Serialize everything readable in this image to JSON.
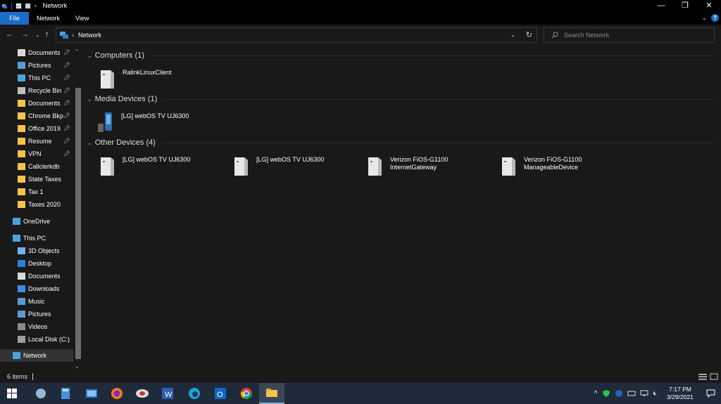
{
  "window": {
    "title": "Network",
    "controls": {
      "minimize": "—",
      "maximize": "❐",
      "close": "✕"
    }
  },
  "ribbon": {
    "tabs": [
      "File",
      "Network",
      "View"
    ]
  },
  "address": {
    "breadcrumb": "Network",
    "search_placeholder": "Search Network"
  },
  "nav": {
    "quick_access": [
      {
        "label": "Documents",
        "icon": "documents-icon",
        "pinned": true
      },
      {
        "label": "Pictures",
        "icon": "pictures-icon",
        "pinned": true
      },
      {
        "label": "This PC",
        "icon": "pc-icon",
        "pinned": true
      },
      {
        "label": "Recycle Bin",
        "icon": "recycle-bin-icon",
        "pinned": true
      },
      {
        "label": "Documents",
        "icon": "folder-icon",
        "pinned": true
      },
      {
        "label": "Chrome Bkp",
        "icon": "folder-icon",
        "pinned": true
      },
      {
        "label": "Office 2019",
        "icon": "folder-icon",
        "pinned": true
      },
      {
        "label": "Resume",
        "icon": "folder-icon",
        "pinned": true
      },
      {
        "label": "VPN",
        "icon": "folder-icon",
        "pinned": true
      },
      {
        "label": "Callclerkdb",
        "icon": "folder-icon",
        "pinned": false
      },
      {
        "label": "State Taxes",
        "icon": "folder-icon",
        "pinned": false
      },
      {
        "label": "Tax 1",
        "icon": "folder-icon",
        "pinned": false
      },
      {
        "label": "Taxes 2020",
        "icon": "folder-icon",
        "pinned": false
      }
    ],
    "onedrive": "OneDrive",
    "this_pc": "This PC",
    "this_pc_items": [
      {
        "label": "3D Objects",
        "icon": "3d-objects-icon"
      },
      {
        "label": "Desktop",
        "icon": "desktop-icon"
      },
      {
        "label": "Documents",
        "icon": "documents-icon"
      },
      {
        "label": "Downloads",
        "icon": "downloads-icon"
      },
      {
        "label": "Music",
        "icon": "music-icon"
      },
      {
        "label": "Pictures",
        "icon": "pictures-icon"
      },
      {
        "label": "Videos",
        "icon": "videos-icon"
      },
      {
        "label": "Local Disk (C:)",
        "icon": "disk-icon"
      }
    ],
    "network": "Network"
  },
  "groups": [
    {
      "title": "Computers (1)",
      "devices": [
        {
          "name": "RalinkLinuxClient",
          "icon": "computer-icon"
        }
      ]
    },
    {
      "title": "Media Devices (1)",
      "devices": [
        {
          "name": "[LG] webOS TV UJ6300",
          "icon": "media-device-icon"
        }
      ]
    },
    {
      "title": "Other Devices (4)",
      "devices": [
        {
          "name": "[LG] webOS TV UJ6300",
          "icon": "computer-icon"
        },
        {
          "name": "[LG] webOS TV UJ6300",
          "icon": "computer-icon"
        },
        {
          "name": "Verizon FiOS-G1100 InternetGateway",
          "line1": "Verizon FiOS-G1100",
          "line2": "InternetGateway",
          "icon": "computer-icon"
        },
        {
          "name": "Verizon FiOS-G1100 ManageableDevice",
          "line1": "Verizon FiOS-G1100",
          "line2": "ManageableDevice",
          "icon": "computer-icon"
        }
      ]
    }
  ],
  "status": {
    "items": "6 items"
  },
  "taskbar": {
    "apps": [
      "cortana-icon",
      "calculator-icon",
      "photos-icon",
      "firefox-icon",
      "vpn-icon",
      "word-icon",
      "edge-icon",
      "outlook-icon",
      "chrome-icon",
      "file-explorer-icon"
    ],
    "time": "7:17 PM",
    "date": "3/29/2021"
  },
  "colors": {
    "accent": "#1a6dc7",
    "folder": "#f3c44b",
    "background": "#191919"
  }
}
